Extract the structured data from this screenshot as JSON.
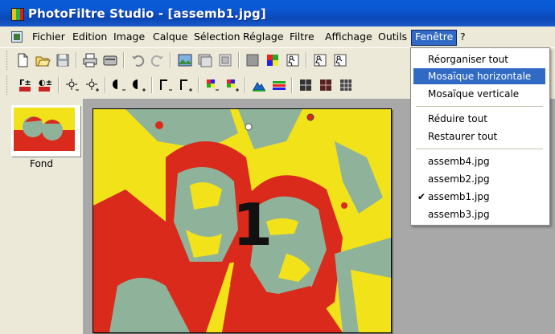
{
  "window": {
    "title": "PhotoFiltre Studio - [assemb1.jpg]"
  },
  "menubar": {
    "items": [
      "Fichier",
      "Edition",
      "Image",
      "Calque",
      "Sélection",
      "Réglage",
      "Filtre",
      "Affichage",
      "Outils",
      "Fenêtre",
      "?"
    ],
    "active": "Fenêtre"
  },
  "toolbar1": {
    "icons": [
      "new-icon",
      "open-icon",
      "save-icon",
      "print-icon",
      "scan-icon",
      "undo-icon",
      "redo-icon",
      "paste-icon",
      "copy-layer-icon",
      "crop-icon",
      "gray-icon",
      "color-icon",
      "transparent-icon",
      "fit-icon",
      "zoom-icon"
    ]
  },
  "toolbar2": {
    "icons": [
      "auto-levels-icon",
      "auto-contrast-icon",
      "brightness-minus-icon",
      "brightness-plus-icon",
      "contrast-minus-icon",
      "contrast-plus-icon",
      "gamma-minus-icon",
      "gamma-plus-icon",
      "saturation-minus-icon",
      "saturation-plus-icon",
      "sharpen-icon",
      "color-balance-icon",
      "grid1-icon",
      "grid2-icon",
      "grid3-icon"
    ]
  },
  "layers": {
    "label": "Fond"
  },
  "canvas": {
    "digit": "1"
  },
  "window_menu": {
    "items": [
      {
        "label": "Réorganiser tout",
        "highlighted": false,
        "checked": false
      },
      {
        "label": "Mosaïque horizontale",
        "highlighted": true,
        "checked": false
      },
      {
        "label": "Mosaïque verticale",
        "highlighted": false,
        "checked": false
      },
      {
        "label": "Réduire tout",
        "highlighted": false,
        "checked": false
      },
      {
        "label": "Restaurer tout",
        "highlighted": false,
        "checked": false
      },
      {
        "label": "assemb4.jpg",
        "highlighted": false,
        "checked": false
      },
      {
        "label": "assemb2.jpg",
        "highlighted": false,
        "checked": false
      },
      {
        "label": "assemb1.jpg",
        "highlighted": false,
        "checked": true
      },
      {
        "label": "assemb3.jpg",
        "highlighted": false,
        "checked": false
      }
    ]
  },
  "colors": {
    "titlebar": "#0a5ad6",
    "highlight": "#316ac5",
    "workspace": "#a8a8a8",
    "red": "#d92a1c",
    "yellow": "#f2e21a",
    "sage": "#8fb39a"
  }
}
